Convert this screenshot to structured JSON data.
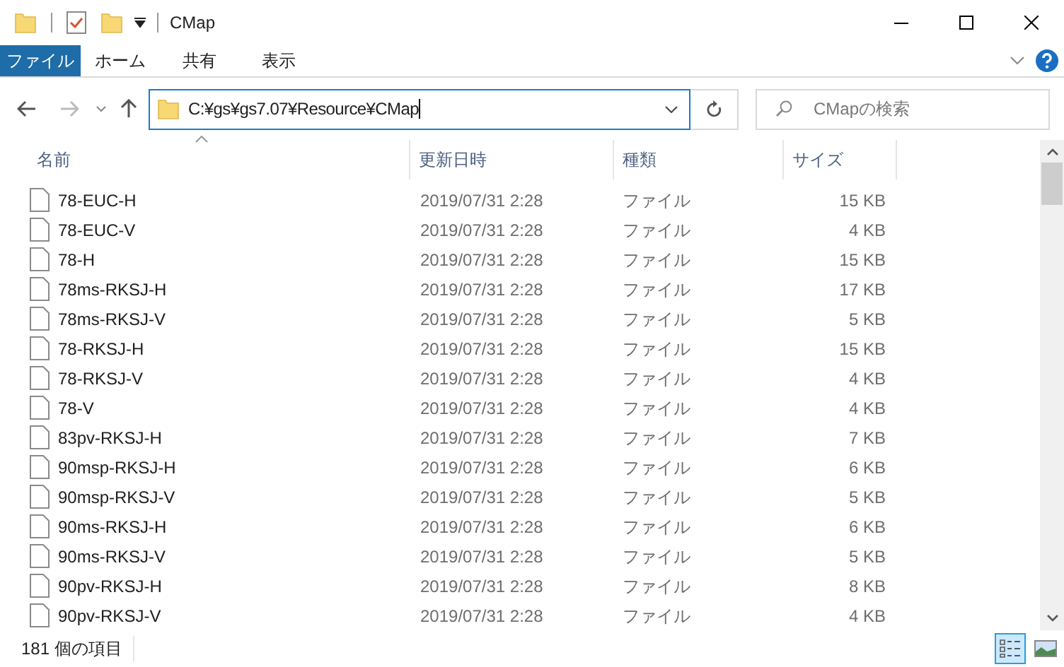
{
  "window": {
    "title": "CMap"
  },
  "ribbon_tabs": [
    {
      "label": "ファイル",
      "kind": "file"
    },
    {
      "label": "ホーム",
      "kind": "tab"
    },
    {
      "label": "共有",
      "kind": "tab"
    },
    {
      "label": "表示",
      "kind": "tab"
    }
  ],
  "address_bar": {
    "value": "C:¥gs¥gs7.07¥Resource¥CMap"
  },
  "search": {
    "placeholder": "CMapの検索"
  },
  "columns": [
    "名前",
    "更新日時",
    "種類",
    "サイズ"
  ],
  "rows": [
    {
      "name": "78-EUC-H",
      "date": "2019/07/31 2:28",
      "type": "ファイル",
      "size": "15 KB"
    },
    {
      "name": "78-EUC-V",
      "date": "2019/07/31 2:28",
      "type": "ファイル",
      "size": "4 KB"
    },
    {
      "name": "78-H",
      "date": "2019/07/31 2:28",
      "type": "ファイル",
      "size": "15 KB"
    },
    {
      "name": "78ms-RKSJ-H",
      "date": "2019/07/31 2:28",
      "type": "ファイル",
      "size": "17 KB"
    },
    {
      "name": "78ms-RKSJ-V",
      "date": "2019/07/31 2:28",
      "type": "ファイル",
      "size": "5 KB"
    },
    {
      "name": "78-RKSJ-H",
      "date": "2019/07/31 2:28",
      "type": "ファイル",
      "size": "15 KB"
    },
    {
      "name": "78-RKSJ-V",
      "date": "2019/07/31 2:28",
      "type": "ファイル",
      "size": "4 KB"
    },
    {
      "name": "78-V",
      "date": "2019/07/31 2:28",
      "type": "ファイル",
      "size": "4 KB"
    },
    {
      "name": "83pv-RKSJ-H",
      "date": "2019/07/31 2:28",
      "type": "ファイル",
      "size": "7 KB"
    },
    {
      "name": "90msp-RKSJ-H",
      "date": "2019/07/31 2:28",
      "type": "ファイル",
      "size": "6 KB"
    },
    {
      "name": "90msp-RKSJ-V",
      "date": "2019/07/31 2:28",
      "type": "ファイル",
      "size": "5 KB"
    },
    {
      "name": "90ms-RKSJ-H",
      "date": "2019/07/31 2:28",
      "type": "ファイル",
      "size": "6 KB"
    },
    {
      "name": "90ms-RKSJ-V",
      "date": "2019/07/31 2:28",
      "type": "ファイル",
      "size": "5 KB"
    },
    {
      "name": "90pv-RKSJ-H",
      "date": "2019/07/31 2:28",
      "type": "ファイル",
      "size": "8 KB"
    },
    {
      "name": "90pv-RKSJ-V",
      "date": "2019/07/31 2:28",
      "type": "ファイル",
      "size": "4 KB"
    }
  ],
  "status_bar": {
    "text": "181 個の項目"
  },
  "view_buttons": [
    {
      "kind": "details",
      "selected": true
    },
    {
      "kind": "large_icons",
      "selected": false
    }
  ]
}
